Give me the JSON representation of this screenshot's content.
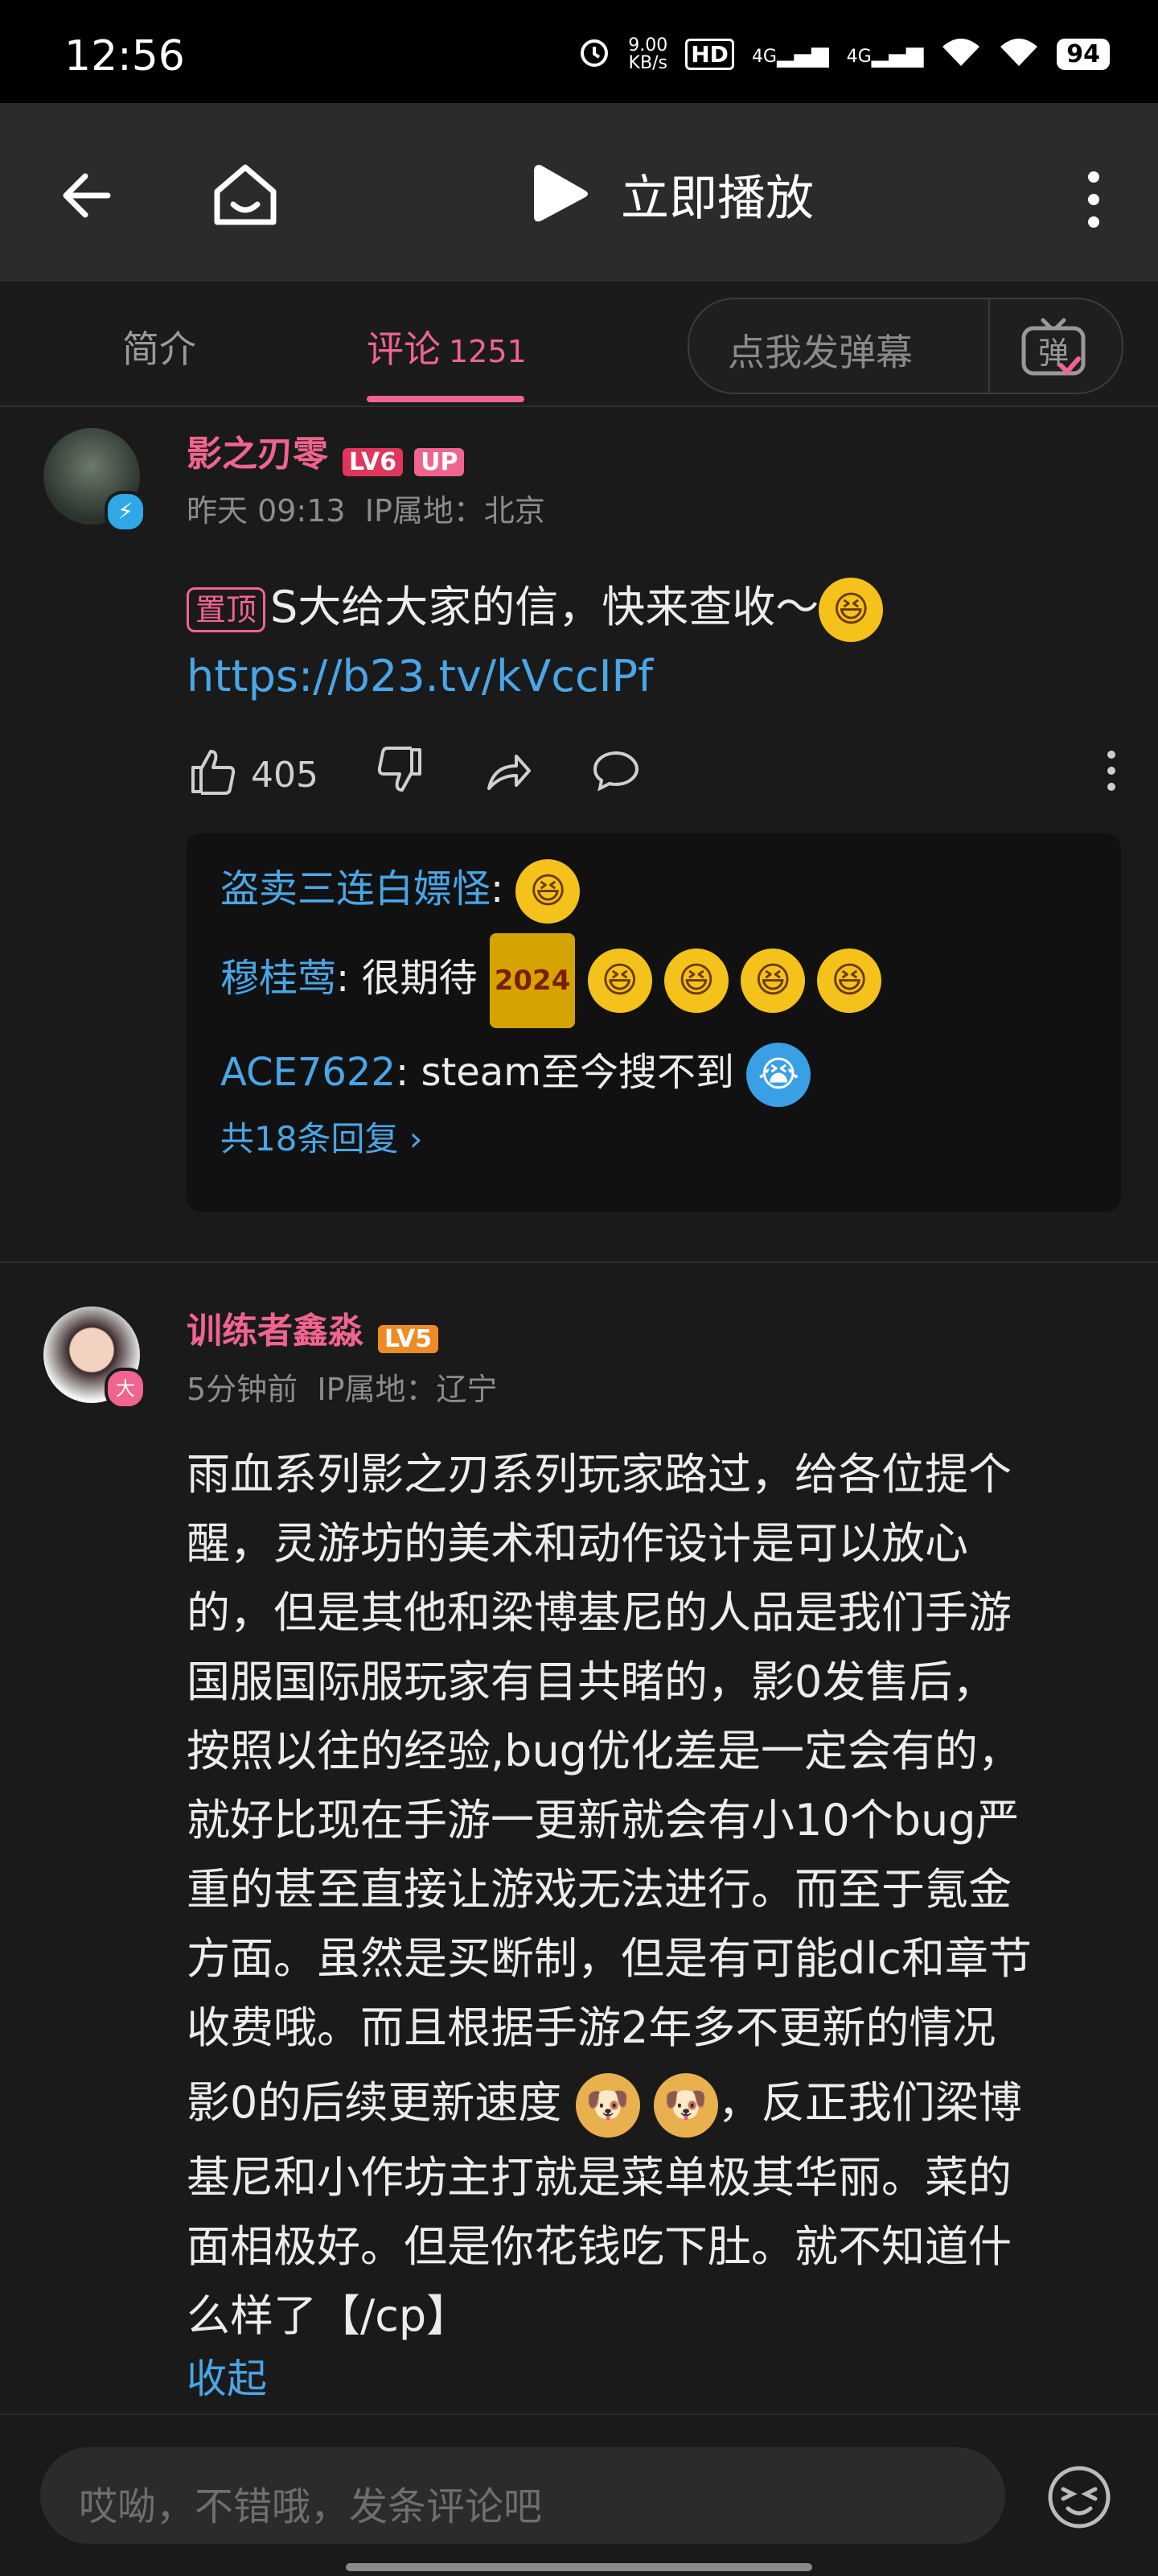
{
  "status_bar": {
    "time": "12:56",
    "net_speed_value": "9.00",
    "net_speed_unit": "KB/s",
    "hd": "HD",
    "sig1": "4G",
    "sig2": "4G",
    "battery": "94"
  },
  "appbar": {
    "title": "立即播放"
  },
  "tabs": {
    "intro": "简介",
    "comments": "评论",
    "comments_count": "1251",
    "danmaku_placeholder": "点我发弹幕",
    "danmaku_icon_glyph": "弹"
  },
  "comment1": {
    "username": "影之刃零",
    "level": "LV6",
    "up_badge": "UP",
    "time": "昨天 09:13",
    "ip": "IP属地：北京",
    "pin_label": "置顶",
    "text": "S大给大家的信，快来查收～",
    "link": "https://b23.tv/kVccIPf",
    "likes": "405",
    "replies": [
      {
        "name": "盗卖三连白嫖怪",
        "text": ""
      },
      {
        "name": "穆桂莺",
        "text": "很期待",
        "tag": "2024"
      },
      {
        "name": "ACE7622",
        "text": "steam至今搜不到"
      }
    ],
    "more_replies": "共18条回复 ›"
  },
  "comment2": {
    "username": "训练者鑫淼",
    "level": "LV5",
    "avatar_badge": "大",
    "time": "5分钟前",
    "ip": "IP属地：辽宁",
    "lines": [
      "雨血系列影之刃系列玩家路过，给各位提个",
      "醒，灵游坊的美术和动作设计是可以放心",
      "的，但是其他和梁博基尼的人品是我们手游",
      "国服国际服玩家有目共睹的，影0发售后，",
      "按照以往的经验,bug优化差是一定会有的，",
      "就好比现在手游一更新就会有小10个bug严",
      "重的甚至直接让游戏无法进行。而至于氪金",
      "方面。虽然是买断制，但是有可能dlc和章节",
      "收费哦。而且根据手游2年多不更新的情况"
    ],
    "line10_a": "影0的后续更新速度",
    "line10_b": "，反正我们梁博",
    "line11": "基尼和小作坊主打就是菜单极其华丽。菜的",
    "line12": "面相极好。但是你花钱吃下肚。就不知道什",
    "line13": "么样了【/cp】",
    "collapse": "收起"
  },
  "bottom": {
    "input_placeholder": "哎呦，不错哦，发条评论吧"
  },
  "colors": {
    "accent": "#f0648f",
    "link": "#4aa6e6",
    "bg": "#1a1a1b"
  }
}
